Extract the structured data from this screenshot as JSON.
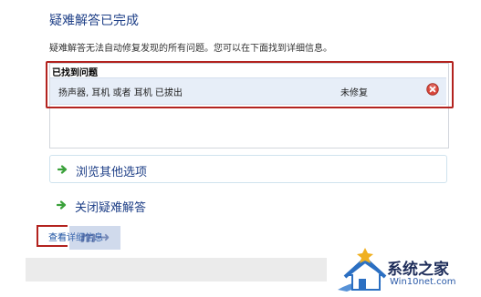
{
  "header": {
    "title": "疑难解答已完成",
    "description": "疑难解答无法自动修复发现的所有问题。您可以在下面找到详细信息。"
  },
  "problems": {
    "header": "已找到问题",
    "rows": [
      {
        "name": "扬声器, 耳机 或者 耳机 已拔出",
        "status": "未修复",
        "status_icon": "error-icon"
      }
    ]
  },
  "options": [
    {
      "label": "浏览其他选项",
      "icon": "green-arrow-icon"
    },
    {
      "label": "关闭疑难解答",
      "icon": "green-arrow-icon"
    }
  ],
  "detail_link": "查看详细信息",
  "watermark": {
    "name": "系统之家",
    "url": "Win10net.com"
  },
  "colors": {
    "title_blue": "#1e3f87",
    "highlight_red": "#b3231f",
    "arrow_green": "#3aa13a",
    "error_red": "#c0392b"
  }
}
